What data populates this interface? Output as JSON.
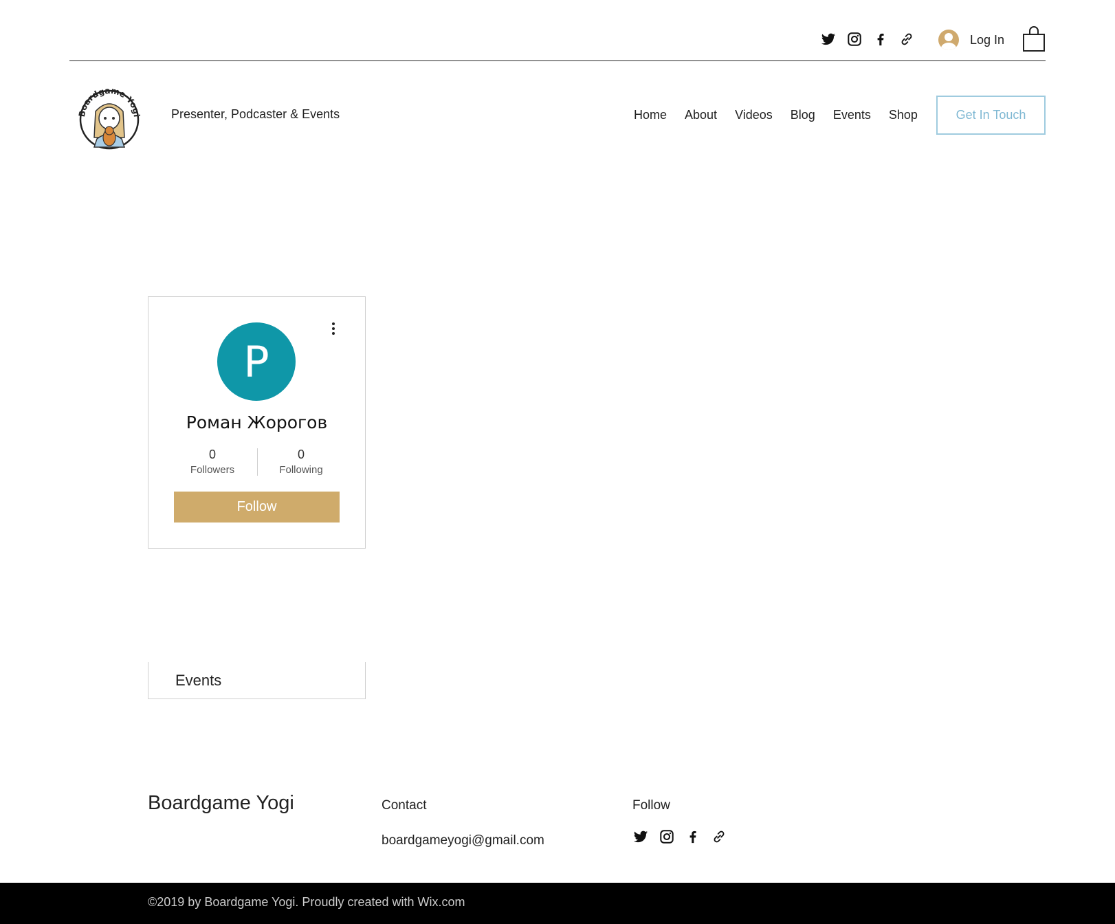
{
  "top_bar": {
    "social": [
      {
        "icon": "twitter-icon"
      },
      {
        "icon": "instagram-icon"
      },
      {
        "icon": "facebook-icon"
      },
      {
        "icon": "link-icon"
      }
    ],
    "login_label": "Log In",
    "cart_icon": "shopping-bag-icon"
  },
  "header": {
    "logo_text": "Boardgame Yogi",
    "tagline": "Presenter, Podcaster & Events",
    "nav": [
      "Home",
      "About",
      "Videos",
      "Blog",
      "Events",
      "Shop"
    ],
    "cta_label": "Get In Touch"
  },
  "profile": {
    "avatar_letter": "P",
    "name": "Роман Жорогов",
    "followers_count": "0",
    "followers_label": "Followers",
    "following_count": "0",
    "following_label": "Following",
    "follow_button": "Follow",
    "menu_icon": "more-vertical-icon"
  },
  "events_tab": {
    "label": "Events"
  },
  "footer": {
    "brand": "Boardgame Yogi",
    "contact_heading": "Contact",
    "email": "boardgameyogi@gmail.com",
    "follow_heading": "Follow",
    "copyright": "©2019 by Boardgame Yogi. Proudly created with Wix.com"
  },
  "colors": {
    "accent_gold": "#cfab6b",
    "avatar_teal": "#0f97a8",
    "cta_border": "#9fcbdf",
    "footer_bar": "#000000"
  }
}
